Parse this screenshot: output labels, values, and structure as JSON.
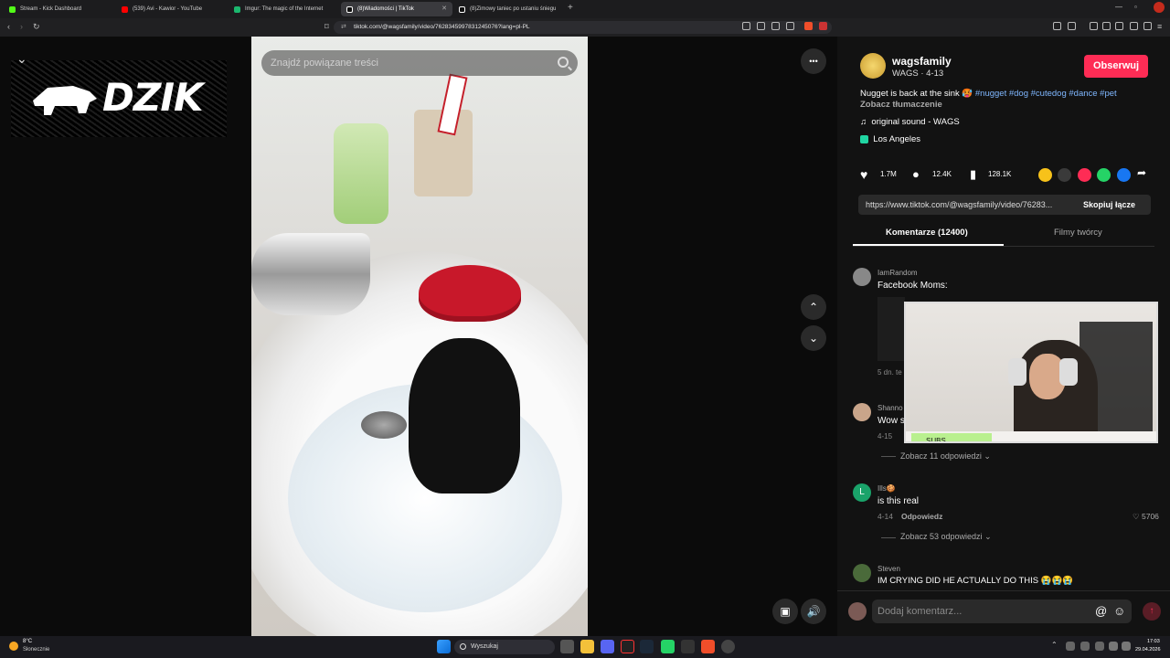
{
  "browser": {
    "tabs": [
      {
        "title": "Stream - Kick Dashboard",
        "color": "#53fc18"
      },
      {
        "title": "(539) Avi - Kawior - YouTube",
        "color": "#ff0000"
      },
      {
        "title": "Imgur: The magic of the Internet",
        "color": "#1bb76e"
      },
      {
        "title": "(8)Wiadomości | TikTok",
        "color": "#ffffff"
      },
      {
        "title": "(8)Zimowy taniec po ustaniu śniegu",
        "color": "#ffffff"
      }
    ],
    "active_tab": 3,
    "url": "tiktok.com/@wagsfamily/video/7628345997831245076?lang=pl-PL",
    "new_tab": "+"
  },
  "overlay": {
    "logo_text": "DZIK",
    "collapse_icon": "chevron-down"
  },
  "video": {
    "search_placeholder": "Znajdź powiązane treści",
    "more_label": "•••"
  },
  "post": {
    "username": "wagsfamily",
    "subline": "WAGS · 4-13",
    "follow_label": "Obserwuj",
    "caption": "Nugget is back at the sink 🥵",
    "hashtags": "#nugget #dog #cutedog #dance #pet",
    "translate": "Zobacz tłumaczenie",
    "sound": "original sound - WAGS",
    "location": "Los Angeles",
    "likes": "1.7M",
    "comments": "12.4K",
    "saves": "128.1K",
    "link": "https://www.tiktok.com/@wagsfamily/video/76283...",
    "copy_label": "Skopiuj łącze",
    "tab_comments": "Komentarze (12400)",
    "tab_creator": "Filmy twórcy"
  },
  "comments": [
    {
      "user": "IamRandom",
      "text": "Facebook Moms:",
      "meta": "5 dn. te"
    },
    {
      "user": "Shanno",
      "text": "Wow s",
      "meta": "4-15",
      "replies": "Zobacz 11 odpowiedzi"
    },
    {
      "user": "Ills🍪",
      "text": "is this real",
      "date": "4-14",
      "reply": "Odpowiedz",
      "likes": "5706",
      "replies": "Zobacz 53 odpowiedzi",
      "avatar_letter": "L"
    },
    {
      "user": "Steven",
      "text": "IM CRYING DID HE ACTUALLY DO THIS 😭😭😭"
    }
  ],
  "comment_input": {
    "placeholder": "Dodaj komentarz..."
  },
  "pip": {
    "badge": "SUBS"
  },
  "taskbar": {
    "weather_temp": "8°C",
    "weather_desc": "Słonecznie",
    "search_label": "Wyszukaj",
    "time": "17:03",
    "date": "29.04.2026"
  }
}
